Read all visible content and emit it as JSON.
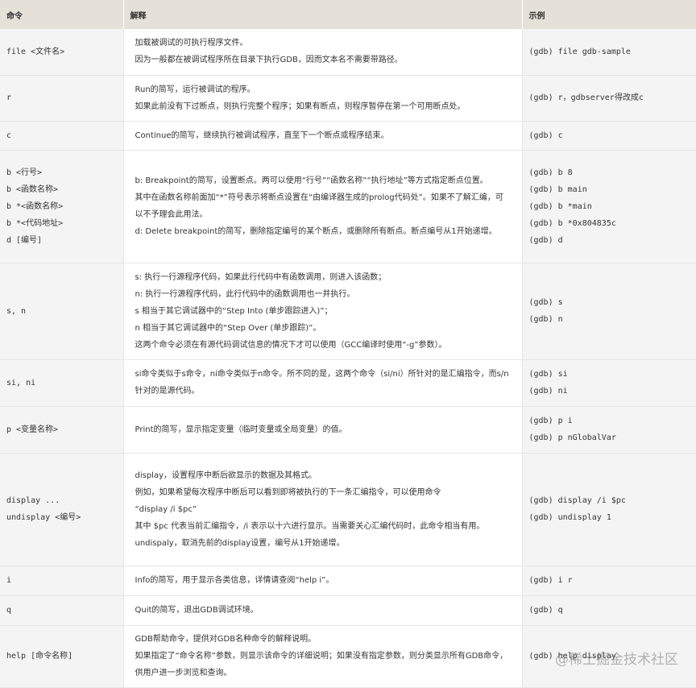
{
  "headers": [
    "命令",
    "解释",
    "示例"
  ],
  "rows": [
    {
      "cmd": [
        "file <文件名>"
      ],
      "desc": [
        "加载被调试的可执行程序文件。",
        "因为一般都在被调试程序所在目录下执行GDB，因而文本名不需要带路径。"
      ],
      "ex": [
        "(gdb) file gdb-sample"
      ],
      "h": 57
    },
    {
      "cmd": [
        "r"
      ],
      "desc": [
        "Run的简写，运行被调试的程序。",
        "如果此前没有下过断点，则执行完整个程序；如果有断点，则程序暂停在第一个可用断点处。"
      ],
      "ex": [
        "(gdb) r，gdbserver得改成c"
      ],
      "h": 57
    },
    {
      "cmd": [
        "c"
      ],
      "desc": [
        "Continue的简写，继续执行被调试程序，直至下一个断点或程序结束。"
      ],
      "ex": [
        "(gdb) c"
      ],
      "h": 36
    },
    {
      "cmd": [
        "b <行号>",
        "b <函数名称>",
        "b *<函数名称>",
        "b *<代码地址>",
        "d [编号]"
      ],
      "desc": [
        "b: Breakpoint的简写，设置断点。两可以使用“行号”“函数名称”“执行地址”等方式指定断点位置。",
        "其中在函数名称前面加“*”符号表示将断点设置在“由编译器生成的prolog代码处”。如果不了解汇编，可以不予理会此用法。",
        "d: Delete breakpoint的简写，删除指定编号的某个断点，或删除所有断点。断点编号从1开始递增。"
      ],
      "ex": [
        "(gdb) b 8",
        "(gdb) b main",
        "(gdb) b *main",
        "(gdb) b *0x804835c",
        "(gdb) d"
      ],
      "h": 140
    },
    {
      "cmd": [
        "s, n"
      ],
      "desc": [
        "s: 执行一行源程序代码，如果此行代码中有函数调用，则进入该函数；",
        "n: 执行一行源程序代码，此行代码中的函数调用也一并执行。",
        "s 相当于其它调试器中的“Step Into (单步跟踪进入)”；",
        "n 相当于其它调试器中的“Step Over (单步跟踪)”。",
        "这两个命令必须在有源代码调试信息的情况下才可以使用（GCC编译时使用“-g”参数）。"
      ],
      "ex": [
        "(gdb) s",
        "(gdb) n"
      ],
      "h": 120
    },
    {
      "cmd": [
        "si, ni"
      ],
      "desc": [
        "si命令类似于s命令，ni命令类似于n命令。所不同的是，这两个命令（si/ni）所针对的是汇编指令，而s/n针对的是源代码。"
      ],
      "ex": [
        "(gdb) si",
        "(gdb) ni"
      ],
      "h": 58
    },
    {
      "cmd": [
        "p <变量名称>"
      ],
      "desc": [
        "Print的简写，显示指定变量（临时变量或全局变量）的值。"
      ],
      "ex": [
        "(gdb) p i",
        "(gdb) p nGlobalVar"
      ],
      "h": 58
    },
    {
      "cmd": [
        "display ...",
        "undisplay <编号>"
      ],
      "desc": [
        "display，设置程序中断后欲显示的数据及其格式。",
        "例如，如果希望每次程序中断后可以看到即将被执行的下一条汇编指令，可以使用命令",
        "“display /i $pc”",
        "其中 $pc 代表当前汇编指令，/i 表示以十六进行显示。当需要关心汇编代码时，此命令相当有用。",
        "undispaly，取消先前的display设置，编号从1开始递增。"
      ],
      "ex": [
        "(gdb) display /i $pc",
        "(gdb) undisplay 1"
      ],
      "h": 140
    },
    {
      "cmd": [
        "i"
      ],
      "desc": [
        "Info的简写，用于显示各类信息，详情请查阅“help i”。"
      ],
      "ex": [
        "(gdb) i r"
      ],
      "h": 37
    },
    {
      "cmd": [
        "q"
      ],
      "desc": [
        "Quit的简写，退出GDB调试环境。"
      ],
      "ex": [
        "(gdb) q"
      ],
      "h": 37
    },
    {
      "cmd": [
        "help [命令名称]"
      ],
      "desc": [
        "GDB帮助命令，提供对GDB名种命令的解释说明。",
        "如果指定了“命令名称”参数，则显示该命令的详细说明；如果没有指定参数，则分类显示所有GDB命令，供用户进一步浏览和查询。"
      ],
      "ex": [
        "(gdb) help display"
      ],
      "h": 77
    }
  ],
  "watermark": "@稀土掘金技术社区"
}
